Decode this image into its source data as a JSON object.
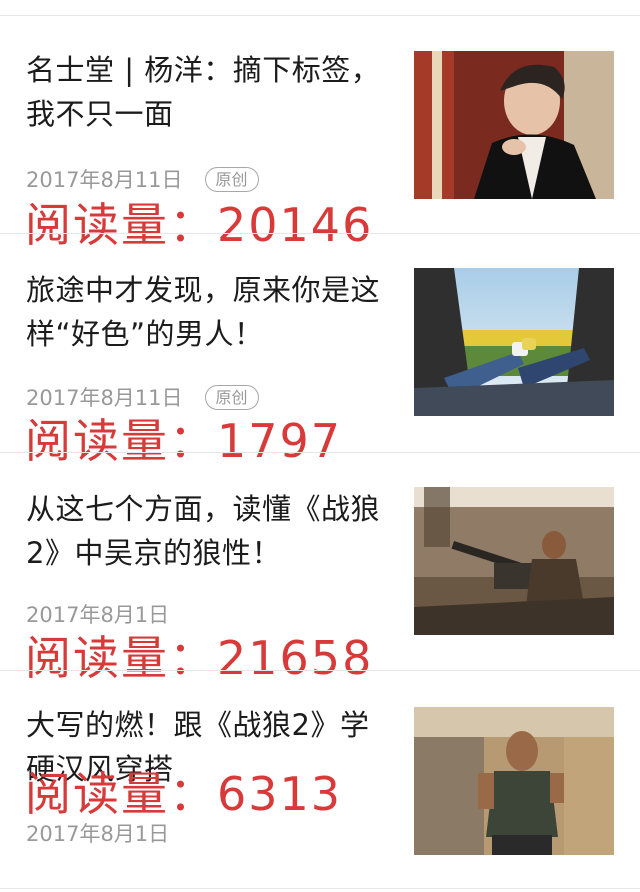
{
  "articles": [
    {
      "title": "名士堂 | 杨洋：摘下标签，我不只一面",
      "date": "2017年8月11日",
      "badge": "原创",
      "reads_label": "阅读量：20146",
      "thumbnail_icon": "portrait-photo-icon"
    },
    {
      "title": "旅途中才发现，原来你是这样“好色”的男人！",
      "date": "2017年8月11日",
      "badge": "原创",
      "reads_label": "阅读量：1797",
      "thumbnail_icon": "car-trip-photo-icon"
    },
    {
      "title": "从这七个方面，读懂《战狼2》中吴京的狼性！",
      "date": "2017年8月1日",
      "badge": "",
      "reads_label": "阅读量：21658",
      "thumbnail_icon": "movie-still-photo-icon"
    },
    {
      "title": "大写的燃！跟《战狼2》学硬汉风穿搭",
      "date": "2017年8月1日",
      "badge": "",
      "reads_label": "阅读量：6313",
      "thumbnail_icon": "actor-photo-icon"
    }
  ],
  "colors": {
    "reads": "#d83a3a",
    "meta": "#999999",
    "title": "#1c1c1c"
  }
}
